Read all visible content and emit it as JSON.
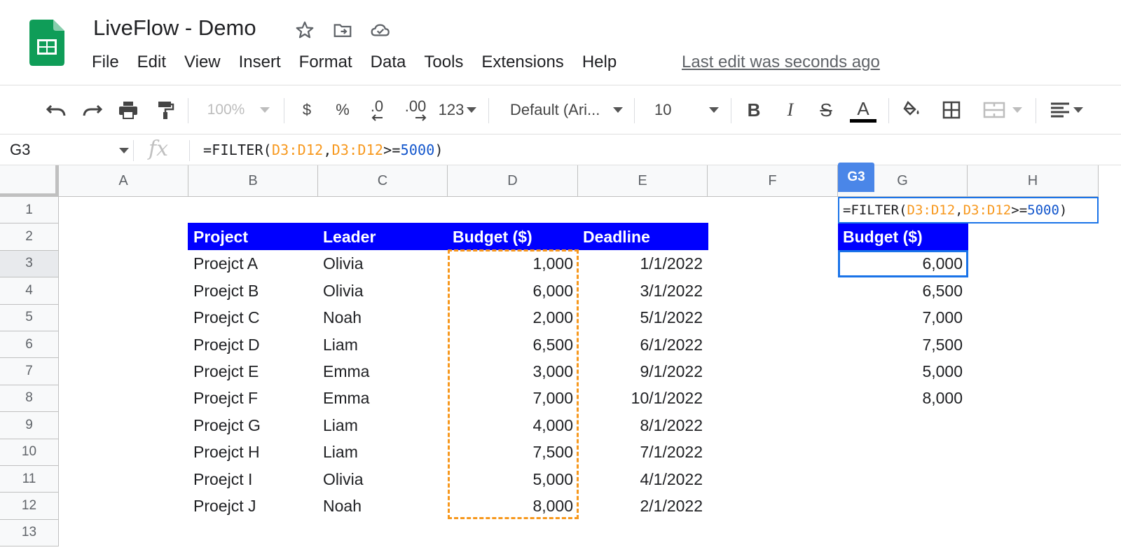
{
  "app": {
    "title": "LiveFlow - Demo",
    "last_edit": "Last edit was seconds ago",
    "menu": [
      "File",
      "Edit",
      "View",
      "Insert",
      "Format",
      "Data",
      "Tools",
      "Extensions",
      "Help"
    ]
  },
  "toolbar": {
    "zoom": "100%",
    "currency": "$",
    "percent": "%",
    "decrease_decimal": ".0",
    "increase_decimal": ".00",
    "more_formats": "123",
    "font": "Default (Ari...",
    "font_size": "10",
    "bold": "B",
    "italic": "I",
    "strikethrough": "S",
    "text_color": "A"
  },
  "formula_bar": {
    "name_box": "G3",
    "fx": "fx",
    "parts": [
      "=FILTER(",
      "D3:D12",
      ",",
      "D3:D12",
      ">=",
      "5000",
      ")"
    ]
  },
  "grid": {
    "columns": [
      "A",
      "B",
      "C",
      "D",
      "E",
      "F",
      "G",
      "H"
    ],
    "rows": [
      "1",
      "2",
      "3",
      "4",
      "5",
      "6",
      "7",
      "8",
      "9",
      "10",
      "11",
      "12",
      "13"
    ],
    "table_headers": [
      "Project",
      "Leader",
      "Budget ($)",
      "Deadline"
    ],
    "table_rows": [
      [
        "Proejct A",
        "Olivia",
        "1,000",
        "1/1/2022"
      ],
      [
        "Proejct B",
        "Olivia",
        "6,000",
        "3/1/2022"
      ],
      [
        "Proejct C",
        "Noah",
        "2,000",
        "5/1/2022"
      ],
      [
        "Proejct D",
        "Liam",
        "6,500",
        "6/1/2022"
      ],
      [
        "Proejct E",
        "Emma",
        "3,000",
        "9/1/2022"
      ],
      [
        "Proejct F",
        "Emma",
        "7,000",
        "10/1/2022"
      ],
      [
        "Proejct G",
        "Liam",
        "4,000",
        "8/1/2022"
      ],
      [
        "Proejct H",
        "Liam",
        "7,500",
        "7/1/2022"
      ],
      [
        "Proejct I",
        "Olivia",
        "5,000",
        "4/1/2022"
      ],
      [
        "Proejct J",
        "Noah",
        "8,000",
        "2/1/2022"
      ]
    ],
    "result_header": "Budget ($)",
    "result_values": [
      "6,000",
      "6,500",
      "7,000",
      "7,500",
      "5,000",
      "8,000"
    ],
    "active_cell_tag": "G3"
  },
  "colors": {
    "header_fill": "#0000ff",
    "range_highlight": "#f7981d",
    "selection": "#1a73e8",
    "sheets_green": "#0f9d58"
  }
}
